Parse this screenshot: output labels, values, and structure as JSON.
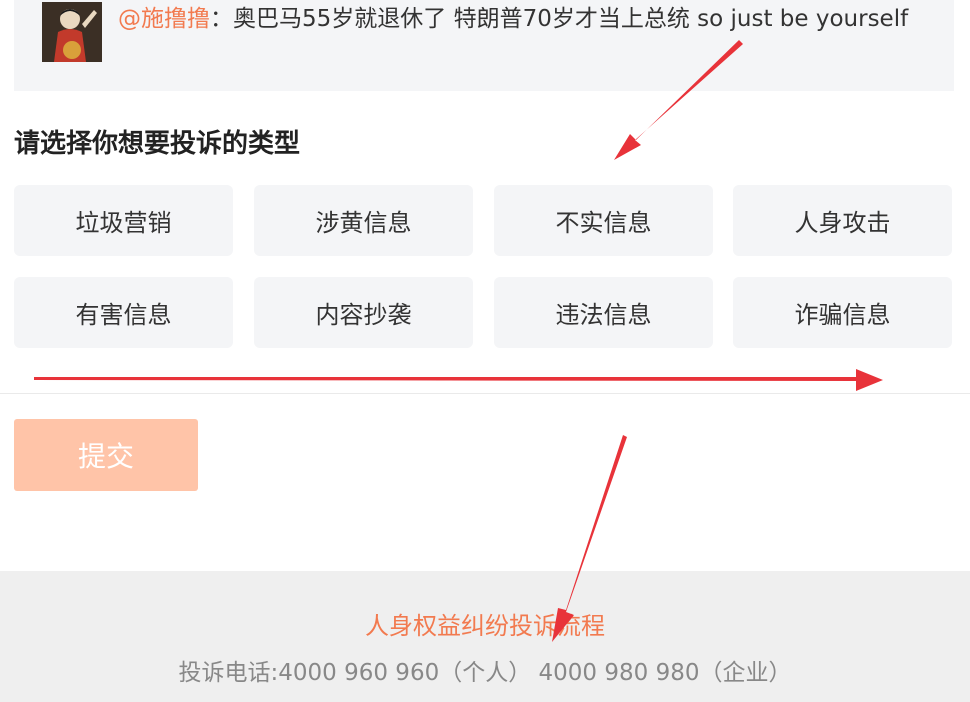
{
  "quote": {
    "username": "@施撸撸",
    "separator": "：",
    "text": "奥巴马55岁就退休了 特朗普70岁才当上总统 so just be yourself"
  },
  "section": {
    "title": "请选择你想要投诉的类型"
  },
  "options": [
    {
      "label": "垃圾营销"
    },
    {
      "label": "涉黄信息"
    },
    {
      "label": "不实信息"
    },
    {
      "label": "人身攻击"
    },
    {
      "label": "有害信息"
    },
    {
      "label": "内容抄袭"
    },
    {
      "label": "违法信息"
    },
    {
      "label": "诈骗信息"
    }
  ],
  "submit": {
    "label": "提交"
  },
  "footer": {
    "link": "人身权益纠纷投诉流程",
    "phone": "投诉电话:4000 960 960（个人） 4000 980 980（企业）"
  },
  "colors": {
    "accent": "#f27a4f",
    "submit_disabled": "#ffc4a8",
    "annotation_arrow": "#e8333a"
  }
}
